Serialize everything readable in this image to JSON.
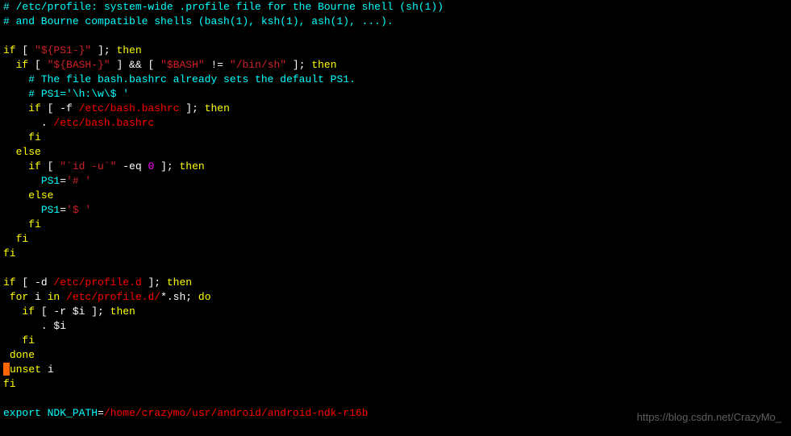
{
  "lines": {
    "l1_a": "# /etc/profile: system-wide .profile file for the Bourne shell (sh(1))",
    "l2_a": "# and Bourne compatible shells (bash(1), ksh(1), ash(1), ...).",
    "l3": "",
    "l4_if": "if",
    "l4_txt": " [ ",
    "l4_str": "\"${PS1-}\"",
    "l4_end": " ]; ",
    "l4_then": "then",
    "l5_sp": "  ",
    "l5_if": "if",
    "l5_t1": " [ ",
    "l5_s1": "\"${BASH-}\"",
    "l5_t2": " ] && [ ",
    "l5_s2": "\"$BASH\"",
    "l5_t3": " != ",
    "l5_s3": "\"/bin/sh\"",
    "l5_t4": " ]; ",
    "l5_then": "then",
    "l6_sp": "    ",
    "l6_c": "# The file bash.bashrc already sets the default PS1.",
    "l7_sp": "    ",
    "l7_c": "# PS1='\\h:\\w\\$ '",
    "l8_sp": "    ",
    "l8_if": "if",
    "l8_t1": " [ -f ",
    "l8_path": "/etc/bash.bashrc",
    "l8_t2": " ]; ",
    "l8_then": "then",
    "l9_sp": "      ",
    "l9_dot": ". ",
    "l9_path": "/etc/bash.bashrc",
    "l10_sp": "    ",
    "l10_fi": "fi",
    "l11_sp": "  ",
    "l11_else": "else",
    "l12_sp": "    ",
    "l12_if": "if",
    "l12_t1": " [ ",
    "l12_s1": "\"`id -u`\"",
    "l12_t2": " -eq ",
    "l12_n": "0",
    "l12_t3": " ]; ",
    "l12_then": "then",
    "l13_sp": "      ",
    "l13_ps1": "PS1",
    "l13_eq": "=",
    "l13_val": "'# '",
    "l14_sp": "    ",
    "l14_else": "else",
    "l15_sp": "      ",
    "l15_ps1": "PS1",
    "l15_eq": "=",
    "l15_val": "'$ '",
    "l16_sp": "    ",
    "l16_fi": "fi",
    "l17_sp": "  ",
    "l17_fi": "fi",
    "l18_fi": "fi",
    "l19": "",
    "l20_if": "if",
    "l20_t1": " [ -d ",
    "l20_path": "/etc/profile.d",
    "l20_t2": " ]; ",
    "l20_then": "then",
    "l21_sp": " ",
    "l21_for": "for",
    "l21_t1": " i ",
    "l21_in": "in",
    "l21_sp2": " ",
    "l21_path": "/etc/profile.d/",
    "l21_glob": "*.sh",
    "l21_t2": "; ",
    "l21_do": "do",
    "l22_sp": "   ",
    "l22_if": "if",
    "l22_t1": " [ -r ",
    "l22_var": "$i",
    "l22_t2": " ]; ",
    "l22_then": "then",
    "l23_sp": "      ",
    "l23_dot": ". ",
    "l23_var": "$i",
    "l24_sp": "   ",
    "l24_fi": "fi",
    "l25_sp": " ",
    "l25_done": "done",
    "l26_sp": " ",
    "l26_unset": "unset",
    "l26_t": " i",
    "l27_fi": "fi",
    "l28": "",
    "l29_export": "export",
    "l29_sp": " ",
    "l29_var": "NDK_PATH",
    "l29_eq": "=",
    "l29_path": "/home/crazymo/usr/android/android-ndk-r16b"
  },
  "watermark": "https://blog.csdn.net/CrazyMo_"
}
